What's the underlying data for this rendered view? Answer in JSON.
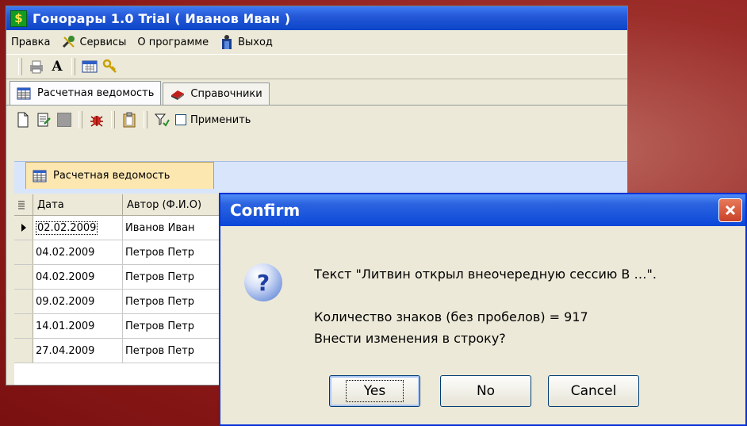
{
  "app": {
    "title": "Гонорары 1.0 Trial ( Иванов Иван )",
    "icon": "dollar-icon"
  },
  "menu": {
    "items": [
      {
        "label": "Правка",
        "icon": null
      },
      {
        "label": "Сервисы",
        "icon": "tools-icon"
      },
      {
        "label": "О программе",
        "icon": null
      },
      {
        "label": "Выход",
        "icon": "exit-icon"
      }
    ]
  },
  "tabs": [
    {
      "label": "Расчетная ведомость",
      "icon": "table-icon"
    },
    {
      "label": "Справочники",
      "icon": "book-icon"
    }
  ],
  "subtoolbar": {
    "checkbox_label": "Применить",
    "checked": false
  },
  "inner_tab": {
    "label": "Расчетная ведомость"
  },
  "grid": {
    "columns": [
      "Дата",
      "Автор (Ф.И.О)"
    ],
    "rows": [
      {
        "date": "02.02.2009",
        "author": "Иванов Иван",
        "current": true
      },
      {
        "date": "04.02.2009",
        "author": "Петров Петр",
        "current": false
      },
      {
        "date": "04.02.2009",
        "author": "Петров Петр",
        "current": false
      },
      {
        "date": "09.02.2009",
        "author": "Петров Петр",
        "current": false
      },
      {
        "date": "14.01.2009",
        "author": "Петров Петр",
        "current": false
      },
      {
        "date": "27.04.2009",
        "author": "Петров Петр",
        "current": false
      }
    ]
  },
  "dialog": {
    "title": "Confirm",
    "line1": "Текст \"Литвин открыл внеочередную сессию В …\".",
    "line2": "Количество знаков (без пробелов) = 917",
    "line3": "Внести изменения в строку?",
    "buttons": {
      "yes": "Yes",
      "no": "No",
      "cancel": "Cancel"
    }
  },
  "colors": {
    "background": "#9c2e2a",
    "titlebar": "#0b45c8",
    "window": "#ece9d8"
  }
}
